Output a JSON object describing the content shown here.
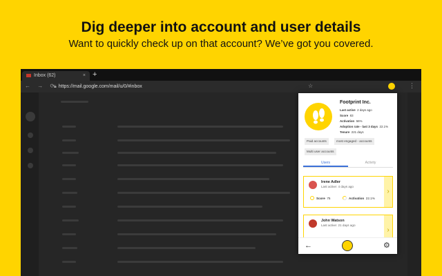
{
  "headline": "Dig deeper into account and user details",
  "subline": "Want to quickly check up on that account? We’ve got you covered.",
  "browser": {
    "tab_title": "Inbox (62)",
    "tab_close": "×",
    "new_tab": "+",
    "nav_icons": "← → ⟳",
    "url": "https://mail.google.com/mail/u/0/#inbox",
    "star": "☆",
    "menu": "⋮"
  },
  "panel": {
    "account_name": "Footprint Inc.",
    "stats": [
      {
        "label": "Last active",
        "value": "2 days ago"
      },
      {
        "label": "Score",
        "value": "83"
      },
      {
        "label": "Activation",
        "value": "56%"
      }
    ],
    "adoption_label": "Adoption rate - last 3 days",
    "adoption_value": "22.1%",
    "tenure_label": "Tenure",
    "tenure_value": "221 days",
    "tags": [
      "Paid accounts",
      "most engaged - accounts",
      "Multi user accounts"
    ],
    "tabs": {
      "users": "Users",
      "activity": "Activity"
    },
    "users": [
      {
        "name": "Irene Adler",
        "last_active": "Last active: 4 days ago",
        "score_label": "Score",
        "score": "75",
        "activation_label": "Activation",
        "activation": "22.1%",
        "avatar_color": "#d9534f"
      },
      {
        "name": "John Watson",
        "last_active": "Last active: 21 days ago",
        "avatar_color": "#c0392b"
      }
    ],
    "back": "←",
    "gear": "⚙",
    "chevron": "›"
  },
  "colors": {
    "accent": "#FFD400",
    "link": "#3a6fd8"
  }
}
